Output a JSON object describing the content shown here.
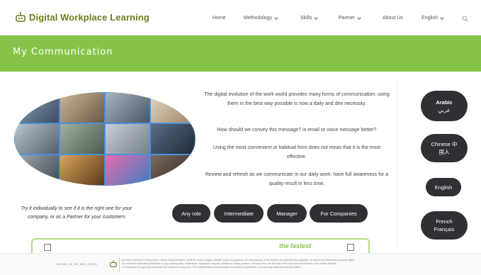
{
  "brand": {
    "name": "Digital Workplace Learning",
    "color": "#6f7c1f"
  },
  "nav": {
    "items": [
      {
        "label": "Home",
        "dropdown": false
      },
      {
        "label": "Methodology",
        "dropdown": true
      },
      {
        "label": "Skills",
        "dropdown": true
      },
      {
        "label": "Partner",
        "dropdown": true
      },
      {
        "label": "About Us",
        "dropdown": false
      },
      {
        "label": "English",
        "dropdown": true
      }
    ],
    "search_icon": "search-icon"
  },
  "banner": {
    "title": "My Communication",
    "color": "#86c349"
  },
  "content": {
    "paragraphs": [
      "The digital evolution of the work world provides many forms of communication: using them in the best way possible is now a daily and dire necessity.",
      "How should we convey this message? is email or voice message better?",
      "Using the most convenient or habitual form does not mean that it is the most effective.",
      "Review and refresh as we communicate in our daily work: have full awareness for a quality result in less time."
    ],
    "note": "Try it individually to see if it is the right one for your company, or as a Partner for your customers"
  },
  "levels": [
    "Any role",
    "Intermediate",
    "Manager",
    "For Companies"
  ],
  "languages": [
    {
      "line1": "Arabic",
      "line2": "عربي"
    },
    {
      "line1": "Chinese 中",
      "line2": "国人"
    },
    {
      "line1": "English",
      "line2": ""
    },
    {
      "line1": "French",
      "line2": "Français"
    }
  ],
  "promo": {
    "text": "the fastest"
  },
  "footer": {
    "code": "IN: DWL_06_HR_ MDL_0_ENG",
    "lines": [
      "All that is reported in this project, videos, documentation, contents, texts, images, details, work and graphics, are the property of the author, are protected by copyright, as well as by intellectual property rights.",
      "It is therefore absolutely forbidden to copy, appropriate, redistribute, reproduce any part, content or image present , because they are the fruit of the work and the intellect of the author himself.",
      "It is forbidden to copy and reproduce the contents in any form.    The redistribution and publication of content is prohibited, not expressly authorized by the author."
    ]
  }
}
